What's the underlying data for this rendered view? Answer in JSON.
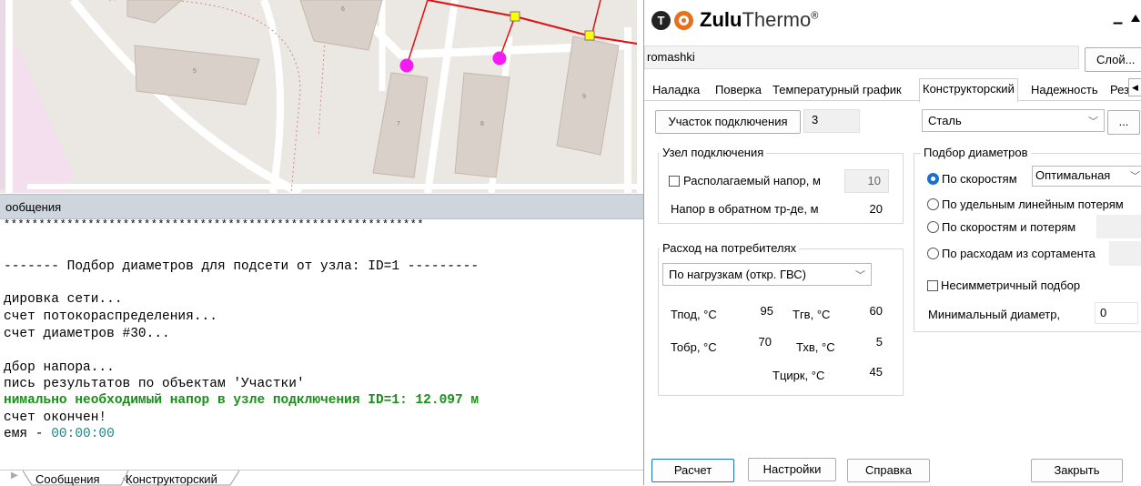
{
  "map": {
    "building_numbers": [
      "6",
      "5",
      "7",
      "8",
      "9"
    ]
  },
  "messages": {
    "header": "ообщения",
    "stars": "************************************************************",
    "lines": [
      "------- Подбор диаметров для подсети от узла: ID=1 ---------",
      "дировка сети...",
      "счет потокораспределения...",
      "счет диаметров #30...",
      "дбор напора...",
      "пись результатов по объектам 'Участки'",
      "нимально необходимый напор в узле подключения ID=1: 12.097 м",
      "счет окончен!"
    ],
    "time_label": "емя - ",
    "time_value": "00:00:00"
  },
  "bottom_tabs": [
    "Сообщения",
    "Конструкторский"
  ],
  "dialog": {
    "app_name_bold": "Zulu",
    "app_name_light": "Thermo",
    "registered": "®",
    "minimize_glyph": "–",
    "project_name": "romashki",
    "layer_button": "Слой...",
    "tabs": [
      "Наладка",
      "Поверка",
      "Температурный график",
      "Конструкторский",
      "Надежность",
      "Рез"
    ],
    "active_tab": "Конструкторский",
    "section_button": "Участок подключения",
    "section_value": "3",
    "material_select": "Сталь",
    "ellipsis_button": "...",
    "node_group": {
      "title": "Узел подключения",
      "available_head_label": "Располагаемый напор, м",
      "available_head_value": "10",
      "return_head_label": "Напор в обратном тр-де, м",
      "return_head_value": "20"
    },
    "consumer_group": {
      "title": "Расход на потребителях",
      "select": "По нагрузкам (откр. ГВС)",
      "tpod_label": "Тпод, °С",
      "tpod_value": "95",
      "tgv_label": "Тгв, °С",
      "tgv_value": "60",
      "tobr_label": "Тобр, °С",
      "tobr_value": "70",
      "thv_label": "Тхв, °С",
      "thv_value": "5",
      "tcirk_label": "Тцирк, °С",
      "tcirk_value": "45"
    },
    "diameter_group": {
      "title": "Подбор диаметров",
      "options": [
        "По скоростям",
        "По удельным линейным потерям",
        "По скоростям и потерям",
        "По расходам из сортамента"
      ],
      "selected_option": "По скоростям",
      "speed_select": "Оптимальная",
      "asymmetric_label": "Несимметричный подбор",
      "min_diameter_label": "Минимальный диаметр,",
      "min_diameter_value": "0"
    },
    "buttons": {
      "calc": "Расчет",
      "settings": "Настройки",
      "help": "Справка",
      "close": "Закрыть"
    }
  },
  "colors": {
    "pipe_red": "#e01010",
    "node_magenta": "#f21bf2",
    "valve_yellow": "#ffff00",
    "result_green": "#1a8f1a",
    "radio_blue": "#1a6fd1"
  }
}
